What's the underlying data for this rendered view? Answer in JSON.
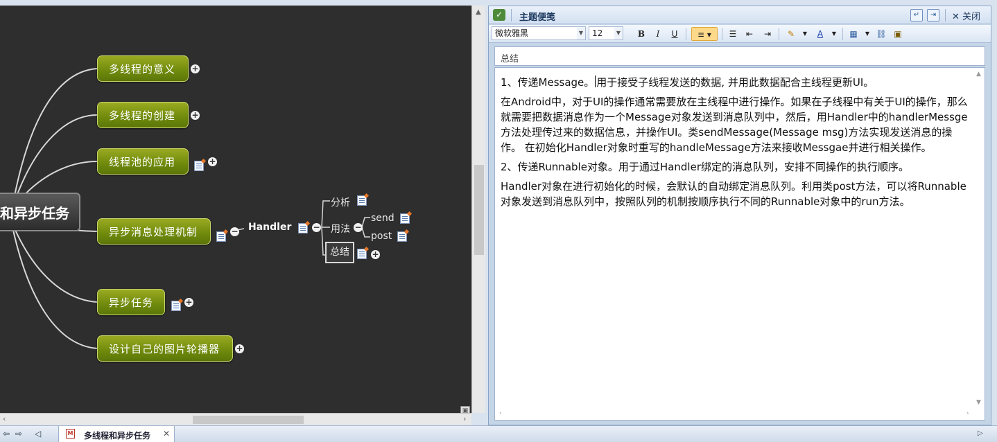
{
  "mindmap": {
    "root_label": "和异步任务",
    "branches": [
      {
        "label": "多线程的意义"
      },
      {
        "label": "多线程的创建"
      },
      {
        "label": "线程池的应用"
      },
      {
        "label": "异步消息处理机制"
      },
      {
        "label": "异步任务"
      },
      {
        "label": "设计自己的图片轮播器"
      }
    ],
    "handler_label": "Handler",
    "analysis_label": "分析",
    "usage_label": "用法",
    "send_label": "send",
    "post_label": "post",
    "summary_label": "总结"
  },
  "panel": {
    "title": "主题便笺",
    "close_label": "关闭",
    "font_name": "微软雅黑",
    "font_size": "12",
    "subject": "总结",
    "paragraphs": {
      "p1_before_caret": "1、传递Message。",
      "p1_after_caret": "用于接受子线程发送的数据, 并用此数据配合主线程更新UI。",
      "p2": "在Android中，对于UI的操作通常需要放在主线程中进行操作。如果在子线程中有关于UI的操作，那么就需要把数据消息作为一个Message对象发送到消息队列中，然后，用Handler中的handlerMessge方法处理传过来的数据信息，并操作UI。类sendMessage(Message msg)方法实现发送消息的操作。 在初始化Handler对象时重写的handleMessage方法来接收Messgae并进行相关操作。",
      "p3": "2、传递Runnable对象。用于通过Handler绑定的消息队列，安排不同操作的执行顺序。",
      "p4": "Handler对象在进行初始化的时候，会默认的自动绑定消息队列。利用类post方法，可以将Runnable对象发送到消息队列中，按照队列的机制按顺序执行不同的Runnable对象中的run方法。"
    }
  },
  "tabbar": {
    "doc_title": "多线程和异步任务"
  },
  "colors": {
    "canvas_bg": "#2e2e2e",
    "node_green": "#6f8a0c",
    "panel_bg": "#c5d5e8",
    "active_button": "#ffd98a"
  }
}
